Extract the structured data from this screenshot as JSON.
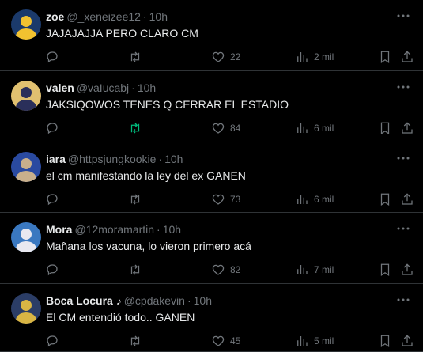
{
  "tweets": [
    {
      "name": "zoe",
      "handle": "@_xeneizee12",
      "sep": "·",
      "time": "10h",
      "text": "JAJAJAJJA PERO CLARO CM",
      "likes": "22",
      "views": "2 mil",
      "retweet_active": false,
      "avatar_colors": [
        "#1b3a6b",
        "#f2c230"
      ]
    },
    {
      "name": "valen",
      "handle": "@vaIucabj",
      "sep": "·",
      "time": "10h",
      "text": "JAKSIQOWOS TENES Q CERRAR EL ESTADIO",
      "likes": "84",
      "views": "6 mil",
      "retweet_active": true,
      "avatar_colors": [
        "#e0c070",
        "#2a2f5a"
      ]
    },
    {
      "name": "iara",
      "handle": "@httpsjungkookie",
      "sep": "·",
      "time": "10h",
      "text": "el cm manifestando la ley del ex GANEN",
      "likes": "73",
      "views": "6 mil",
      "retweet_active": false,
      "avatar_colors": [
        "#2a4aa0",
        "#c9b08c"
      ]
    },
    {
      "name": "Mora",
      "handle": "@12moramartin",
      "sep": "·",
      "time": "10h",
      "text": "Mañana los vacuna, lo vieron primero acá",
      "likes": "82",
      "views": "7 mil",
      "retweet_active": false,
      "avatar_colors": [
        "#3a78c0",
        "#e8e8f0"
      ]
    },
    {
      "name": "Boca Locura ♪",
      "handle": "@cpdakevin",
      "sep": "·",
      "time": "10h",
      "text": "El CM entendió todo.. GANEN",
      "likes": "45",
      "views": "5 mil",
      "retweet_active": false,
      "avatar_colors": [
        "#2b3d66",
        "#d9b544"
      ]
    }
  ],
  "icons": {
    "reply": "reply-icon",
    "retweet": "retweet-icon",
    "like": "heart-icon",
    "views": "views-icon",
    "bookmark": "bookmark-icon",
    "share": "share-icon",
    "more": "more-icon"
  },
  "colors": {
    "background": "#000000",
    "text": "#e7e9ea",
    "muted": "#71767b",
    "divider": "#2f3336",
    "retweet_active": "#00ba7c"
  }
}
